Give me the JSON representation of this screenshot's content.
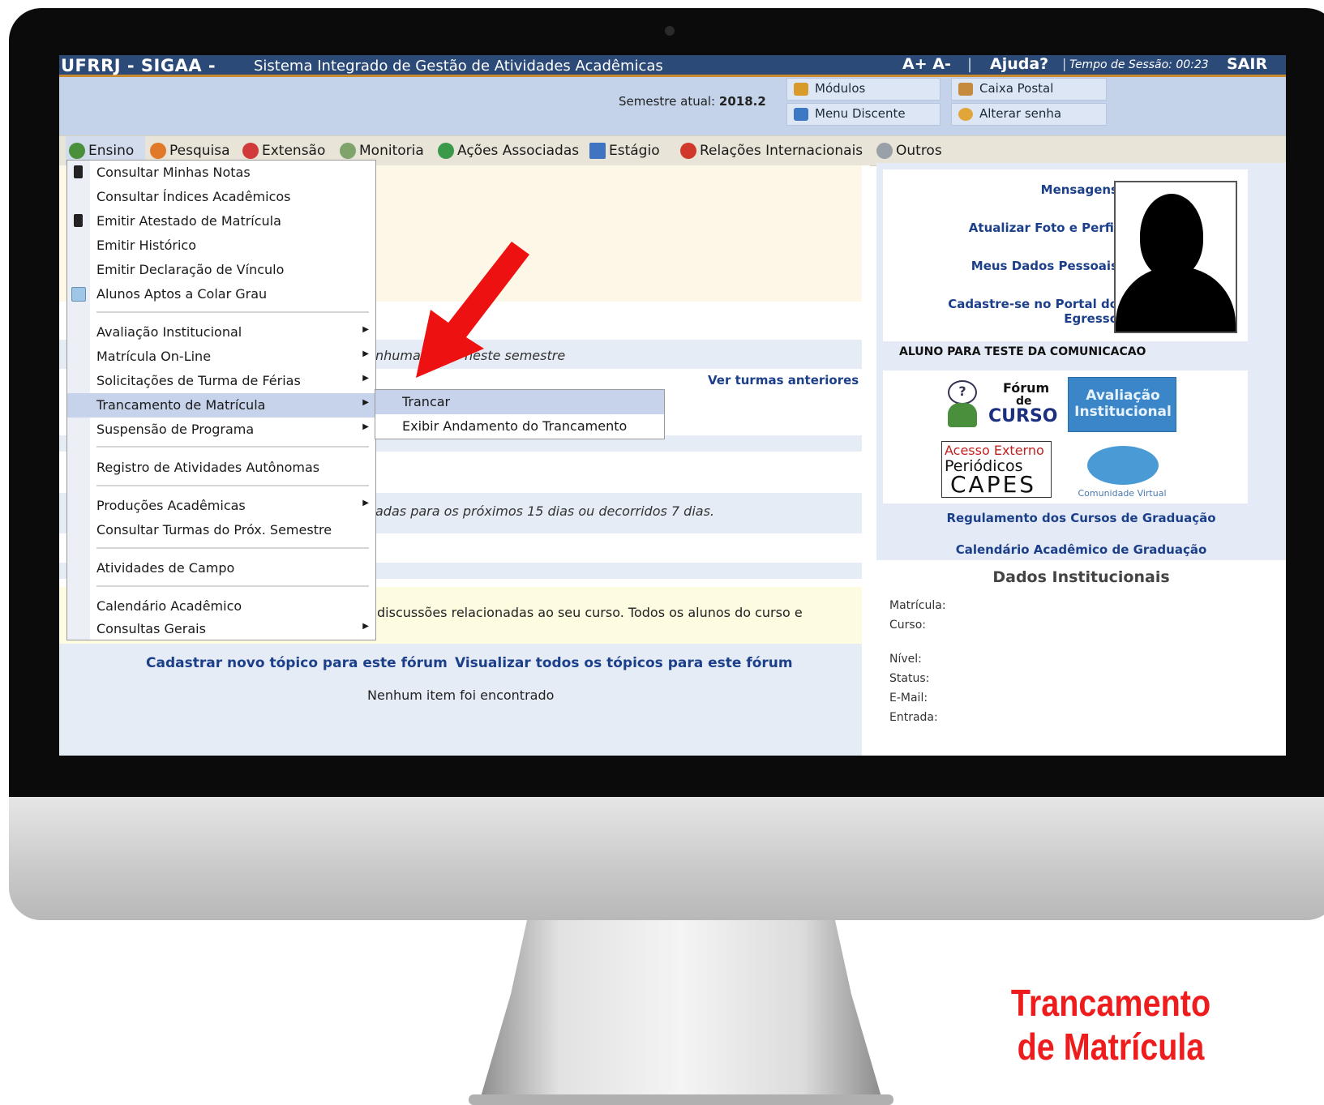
{
  "header": {
    "title": "UFRRJ - SIGAA -",
    "subtitle": "Sistema Integrado de Gestão de Atividades Acadêmicas",
    "font_controls": "A+ A-",
    "separator": "|",
    "help": "Ajuda?",
    "session": "Tempo de Sessão: 00:23",
    "logout": "SAIR"
  },
  "info": {
    "semester_label": "Semestre atual:",
    "semester_value": "2018.2",
    "buttons": {
      "modulos": "Módulos",
      "caixa_postal": "Caixa Postal",
      "menu_discente": "Menu Discente",
      "alterar_senha": "Alterar senha"
    }
  },
  "menubar": {
    "tabs": [
      "Ensino",
      "Pesquisa",
      "Extensão",
      "Monitoria",
      "Ações Associadas",
      "Estágio",
      "Relações Internacionais",
      "Outros"
    ]
  },
  "dropdown": {
    "items": [
      "Consultar Minhas Notas",
      "Consultar Índices Acadêmicos",
      "Emitir Atestado de Matrícula",
      "Emitir Histórico",
      "Emitir Declaração de Vínculo",
      "Alunos Aptos a Colar Grau",
      "Avaliação Institucional",
      "Matrícula On-Line",
      "Solicitações de Turma de Férias",
      "Trancamento de Matrícula",
      "Suspensão de Programa",
      "Registro de Atividades Autônomas",
      "Produções Acadêmicas",
      "Consultar Turmas do Próx. Semestre",
      "Atividades de Campo",
      "Calendário Acadêmico",
      "Consultas Gerais"
    ],
    "submenu": [
      "Trancar",
      "Exibir Andamento do Trancamento"
    ],
    "arrow_glyph": "▶"
  },
  "content": {
    "turmas_text_a": "nhuma",
    "turmas_text_b": "neste semestre",
    "ver_turmas": "Ver turmas anteriores",
    "atividades_text": "adas para os próximos 15 dias ou decorridos 7 dias.",
    "forum_text": "discussões relacionadas ao seu curso. Todos os alunos do curso e",
    "cadastrar_topico": "Cadastrar novo tópico para este fórum",
    "visualizar_topicos": "Visualizar todos os tópicos para este fórum",
    "nenhum_item": "Nenhum item foi encontrado"
  },
  "sidebar": {
    "links": [
      "Mensagens",
      "Atualizar Foto e Perfil",
      "Meus Dados Pessoais",
      "Cadastre-se no Portal do Egresso"
    ],
    "student_name": "ALUNO PARA TESTE DA COMUNICACAO",
    "badges": {
      "forum_line1": "Fórum",
      "forum_line2": "de",
      "forum_line3": "CURSO",
      "avaliacao_line1": "Avaliação",
      "avaliacao_line2": "Institucional",
      "capes_line1": "Acesso Externo",
      "capes_line2": "Periódicos",
      "capes_line3": "CAPES",
      "comunidade": "Comunidade Virtual"
    },
    "regulamento": "Regulamento dos Cursos de Graduação",
    "calendario": "Calendário Acadêmico de Graduação",
    "dados_title": "Dados Institucionais",
    "dados_fields": [
      "Matrícula:",
      "Curso:",
      "Nível:",
      "Status:",
      "E-Mail:",
      "Entrada:"
    ]
  },
  "caption": {
    "line1": "Trancamento",
    "line2": "de Matrícula"
  },
  "colors": {
    "header_blue": "#2b4a78",
    "link_blue": "#1c3f8a",
    "caption_red": "#ee1c1c",
    "highlight": "#c7d3ea"
  }
}
